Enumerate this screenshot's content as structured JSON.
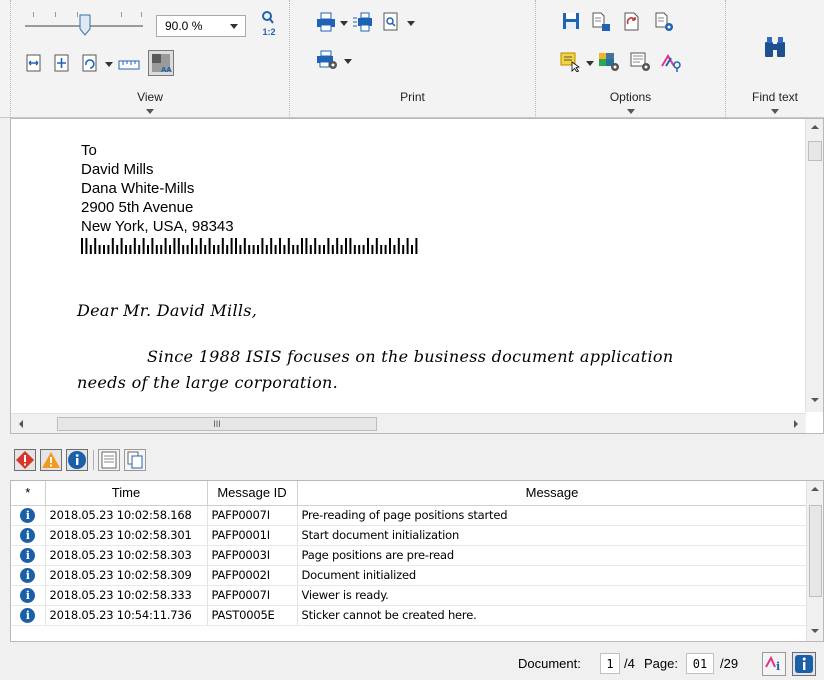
{
  "ribbon": {
    "view": {
      "label": "View",
      "zoom_value": "90.0 %",
      "zoom_ratio_icon": "1:2"
    },
    "print": {
      "label": "Print"
    },
    "options": {
      "label": "Options"
    },
    "find": {
      "label": "Find text"
    }
  },
  "document": {
    "address_lines": [
      "To",
      "David Mills",
      "Dana White-Mills",
      "2900 5th Avenue",
      "New York, USA, 98343"
    ],
    "greeting": "Dear Mr. David Mills,",
    "body_line1": "Since 1988 ISIS focuses on the business document application",
    "body_line2": "needs of the large corporation.",
    "hscroll_grip": "III"
  },
  "messages": {
    "columns": {
      "flag": "*",
      "time": "Time",
      "id": "Message ID",
      "message": "Message"
    },
    "rows": [
      {
        "time": "2018.05.23 10:02:58.168",
        "id": "PAFP0007I",
        "message": "Pre-reading of page positions started"
      },
      {
        "time": "2018.05.23 10:02:58.301",
        "id": "PAFP0001I",
        "message": "Start document initialization"
      },
      {
        "time": "2018.05.23 10:02:58.303",
        "id": "PAFP0003I",
        "message": "Page positions are pre-read"
      },
      {
        "time": "2018.05.23 10:02:58.309",
        "id": "PAFP0002I",
        "message": "Document initialized"
      },
      {
        "time": "2018.05.23 10:02:58.333",
        "id": "PAFP0007I",
        "message": "Viewer is ready."
      },
      {
        "time": "2018.05.23 10:54:11.736",
        "id": "PAST0005E",
        "message": "Sticker cannot be created here."
      }
    ]
  },
  "status": {
    "document_label": "Document:",
    "document_value": "1",
    "document_total": "/4",
    "page_label": "Page:",
    "page_value": "01",
    "page_total": "/29"
  },
  "colors": {
    "info_blue": "#1a5fa8",
    "error_red": "#d9362b",
    "warning_orange": "#f29a1d"
  }
}
